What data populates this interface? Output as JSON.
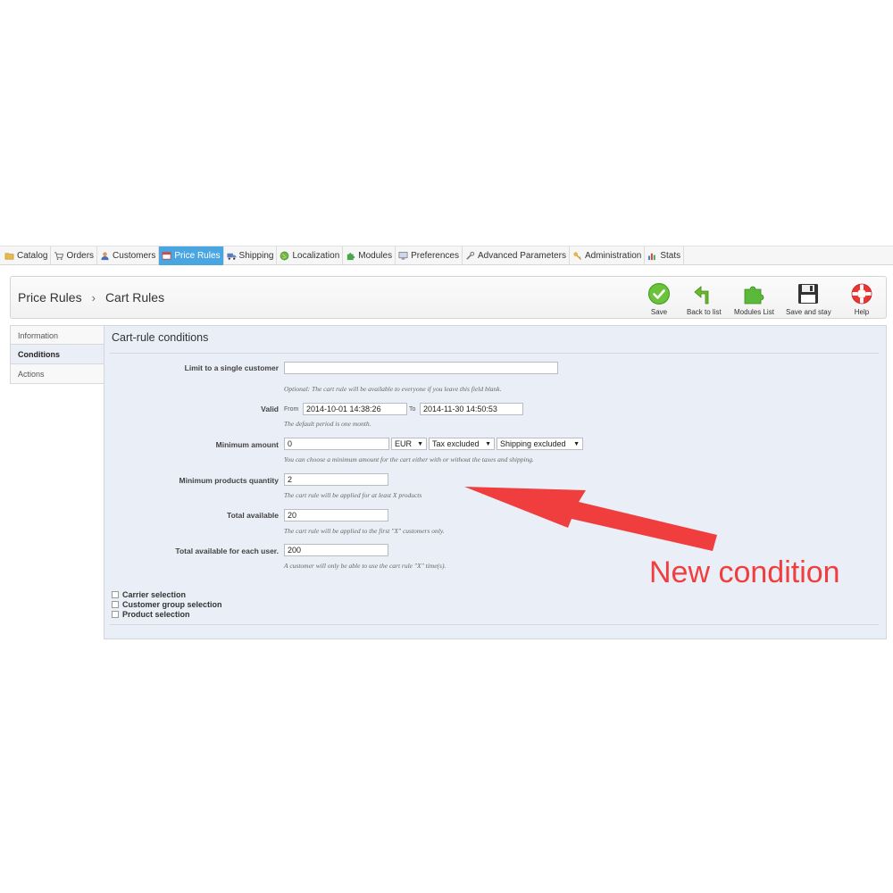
{
  "menu": [
    {
      "label": "Catalog",
      "icon": "folder-icon",
      "active": false
    },
    {
      "label": "Orders",
      "icon": "cart-icon",
      "active": false
    },
    {
      "label": "Customers",
      "icon": "user-icon",
      "active": false
    },
    {
      "label": "Price Rules",
      "icon": "price-tag-icon",
      "active": true
    },
    {
      "label": "Shipping",
      "icon": "truck-icon",
      "active": false
    },
    {
      "label": "Localization",
      "icon": "globe-icon",
      "active": false
    },
    {
      "label": "Modules",
      "icon": "puzzle-icon",
      "active": false
    },
    {
      "label": "Preferences",
      "icon": "monitor-icon",
      "active": false
    },
    {
      "label": "Advanced Parameters",
      "icon": "wrench-icon",
      "active": false
    },
    {
      "label": "Administration",
      "icon": "key-icon",
      "active": false
    },
    {
      "label": "Stats",
      "icon": "bar-chart-icon",
      "active": false
    }
  ],
  "breadcrumb": {
    "parent": "Price Rules",
    "separator": "›",
    "current": "Cart Rules"
  },
  "toolbar": {
    "save": "Save",
    "back": "Back to list",
    "modules": "Modules List",
    "save_stay": "Save and stay",
    "help": "Help"
  },
  "tabs": [
    "Information",
    "Conditions",
    "Actions"
  ],
  "panel": {
    "title": "Cart-rule conditions",
    "limit_label": "Limit to a single customer",
    "limit_value": "",
    "limit_hint": "Optional: The cart rule will be available to everyone if you leave this field blank.",
    "valid_label": "Valid",
    "from_label": "From",
    "from_value": "2014-10-01 14:38:26",
    "to_label": "To",
    "to_value": "2014-11-30 14:50:53",
    "valid_hint": "The default period is one month.",
    "min_amount_label": "Minimum amount",
    "min_amount_value": "0",
    "currency": "EUR",
    "tax": "Tax excluded",
    "shipping": "Shipping excluded",
    "min_amount_hint": "You can choose a minimum amount for the cart either with or without the taxes and shipping.",
    "min_qty_label": "Minimum products quantity",
    "min_qty_value": "2",
    "min_qty_hint": "The cart rule will be applied for at least X products",
    "total_label": "Total available",
    "total_value": "20",
    "total_hint": "The cart rule will be applied to the first \"X\" customers only.",
    "per_user_label": "Total available for each user.",
    "per_user_value": "200",
    "per_user_hint": "A customer will only be able to use the cart rule \"X\" time(s).",
    "checkboxes": [
      "Carrier selection",
      "Customer group selection",
      "Product selection"
    ]
  },
  "annotation": {
    "text": "New condition",
    "color": "#f03e3e"
  },
  "colors": {
    "accent": "#4aa6e0",
    "panel": "#eaeef6",
    "annotation": "#f03e3e"
  }
}
